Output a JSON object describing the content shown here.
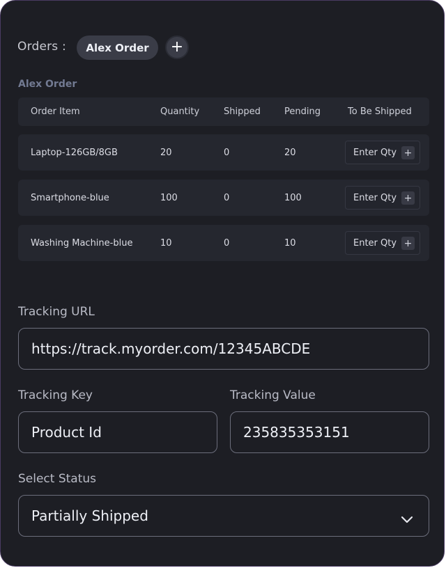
{
  "orders": {
    "label": "Orders :",
    "active_order": "Alex Order",
    "add_icon": "plus-icon"
  },
  "table": {
    "title": "Alex Order",
    "headers": [
      "Order Item",
      "Quantity",
      "Shipped",
      "Pending",
      "To Be Shipped"
    ],
    "rows": [
      {
        "item": "Laptop-126GB/8GB",
        "quantity": "20",
        "shipped": "0",
        "pending": "20",
        "qty_placeholder": "Enter Qty"
      },
      {
        "item": "Smartphone-blue",
        "quantity": "100",
        "shipped": "0",
        "pending": "100",
        "qty_placeholder": "Enter Qty"
      },
      {
        "item": "Washing Machine-blue",
        "quantity": "10",
        "shipped": "0",
        "pending": "10",
        "qty_placeholder": "Enter Qty"
      }
    ]
  },
  "tracking": {
    "url_label": "Tracking URL",
    "url_value": "https://track.myorder.com/12345ABCDE",
    "key_label": "Tracking Key",
    "key_value": "Product Id",
    "value_label": "Tracking Value",
    "value_value": "235835353151"
  },
  "status": {
    "label": "Select Status",
    "value": "Partially Shipped",
    "icon": "chevron-down-icon"
  },
  "colors": {
    "panel_bg": "#1d1e24",
    "row_bg": "#25272f",
    "pill_bg": "#3a3c47",
    "border": "#6c6e7c",
    "accent_muted": "#727a92"
  }
}
